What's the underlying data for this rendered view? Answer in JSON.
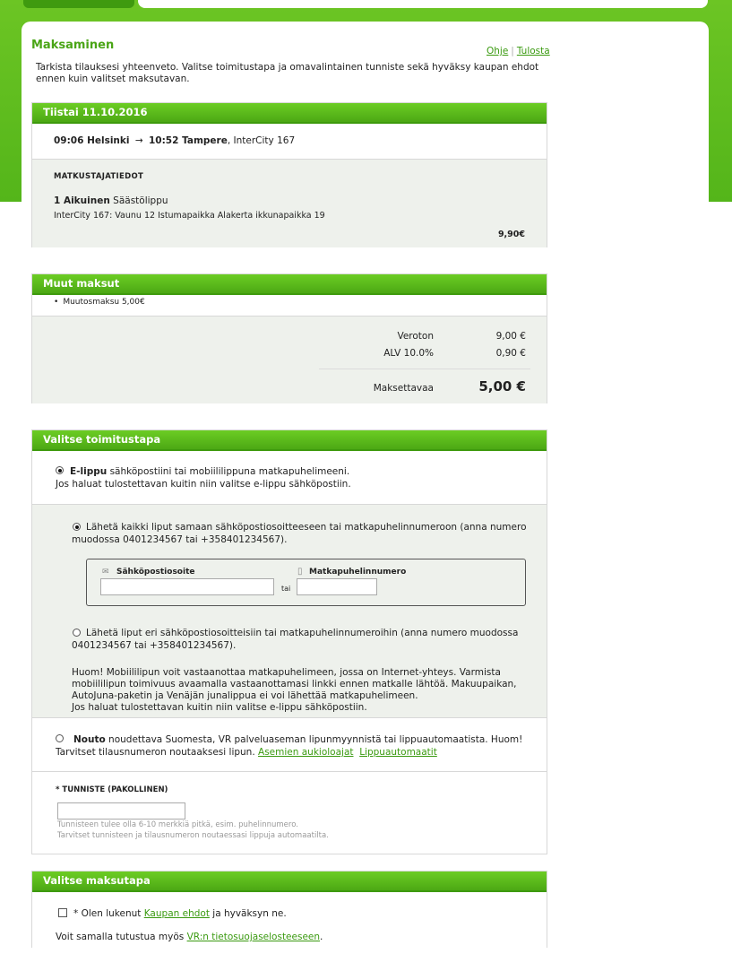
{
  "page": {
    "title": "Maksaminen",
    "links": {
      "print_view": "Ohje",
      "print": "Tulosta"
    },
    "intro": "Tarkista tilauksesi yhteenveto. Valitse toimitustapa ja omavalintainen tunniste sekä hyväksy kaupan ehdot ennen kuin valitset maksutavan."
  },
  "trip": {
    "date": "Tiistai 11.10.2016",
    "depart_time_place": "09:06 Helsinki",
    "arrow": "→",
    "arrive_time_place": "10:52 Tampere",
    "train": ", InterCity 167",
    "traveller_header": "MATKUSTAJATIEDOT",
    "passenger_count": "1 Aikuinen",
    "ticket_type": "Säästölippu",
    "seat_info": "InterCity 167: Vaunu 12 Istumapaikka Alakerta ikkunapaikka 19",
    "price": "9,90€"
  },
  "other_fees": {
    "header": "Muut maksut",
    "items": [
      "Muutosmaksu 5,00€"
    ],
    "net_label": "Veroton",
    "net_value": "9,00 €",
    "vat_label": "ALV 10.0%",
    "vat_value": "0,90 €",
    "total_label": "Maksettavaa",
    "total_value": "5,00 €"
  },
  "delivery": {
    "header": "Valitse toimitustapa",
    "eticket_title": "E-lippu",
    "eticket_text": " sähköpostiini tai mobiililippuna matkapuhelimeeni.",
    "eticket_text2": "Jos haluat tulostettavan kuitin niin valitse e-lippu sähköpostiin.",
    "send_all_line1": "Lähetä kaikki liput samaan sähköpostiosoitteeseen tai matkapuhelinnumeroon (anna numero",
    "send_all_line2": "muodossa 0401234567 tai +358401234567).",
    "email_label": "Sähköpostiosoite",
    "or_label": "tai",
    "phone_label": "Matkapuhelinnumero",
    "email_value": "",
    "phone_value": "",
    "send_separate_line1": "Lähetä liput eri sähköpostiosoitteisiin tai matkapuhelinnumeroihin (anna numero muodossa",
    "send_separate_line2": "0401234567 tai +358401234567).",
    "note1": "Huom! Mobiililipun voit vastaanottaa matkapuhelimeen, jossa on Internet-yhteys. Varmista",
    "note2": "mobiililipun toimivuus avaamalla vastaanottamasi linkki ennen matkalle lähtöä. Makuupaikan,",
    "note3": "AutoJuna-paketin ja Venäjän junalippua ei voi lähettää matkapuhelimeen.",
    "note4": "Jos haluat tulostettavan kuitin niin valitse e-lippu sähköpostiin.",
    "pickup_title": "Nouto",
    "pickup_text1": " noudettava Suomesta, VR palveluaseman lipunmyynnistä tai lippuautomaatista. Huom!",
    "pickup_text2": "Tarvitset tilausnumeron noutaaksesi lipun.",
    "station_hours_link": "Asemien aukioloajat",
    "ticket_machines_link": "Lippuautomaatit",
    "identifier_label": "* TUNNISTE (PAKOLLINEN)",
    "identifier_value": "",
    "identifier_help1": "Tunnisteen tulee olla 6-10 merkkiä pitkä, esim. puhelinnumero.",
    "identifier_help2": "Tarvitset tunnisteen ja tilausnumeron noutaessasi lippuja automaatilta."
  },
  "payment": {
    "header": "Valitse maksutapa",
    "terms_prefix": "* Olen lukenut ",
    "terms_link": "Kaupan ehdot",
    "terms_suffix": " ja hyväksyn ne.",
    "privacy_prefix": "Voit samalla tutustua myös ",
    "privacy_link": "VR:n tietosuojaselosteeseen",
    "privacy_suffix": "."
  },
  "colors": {
    "accent": "#54b51a",
    "link": "#3a9a10"
  }
}
